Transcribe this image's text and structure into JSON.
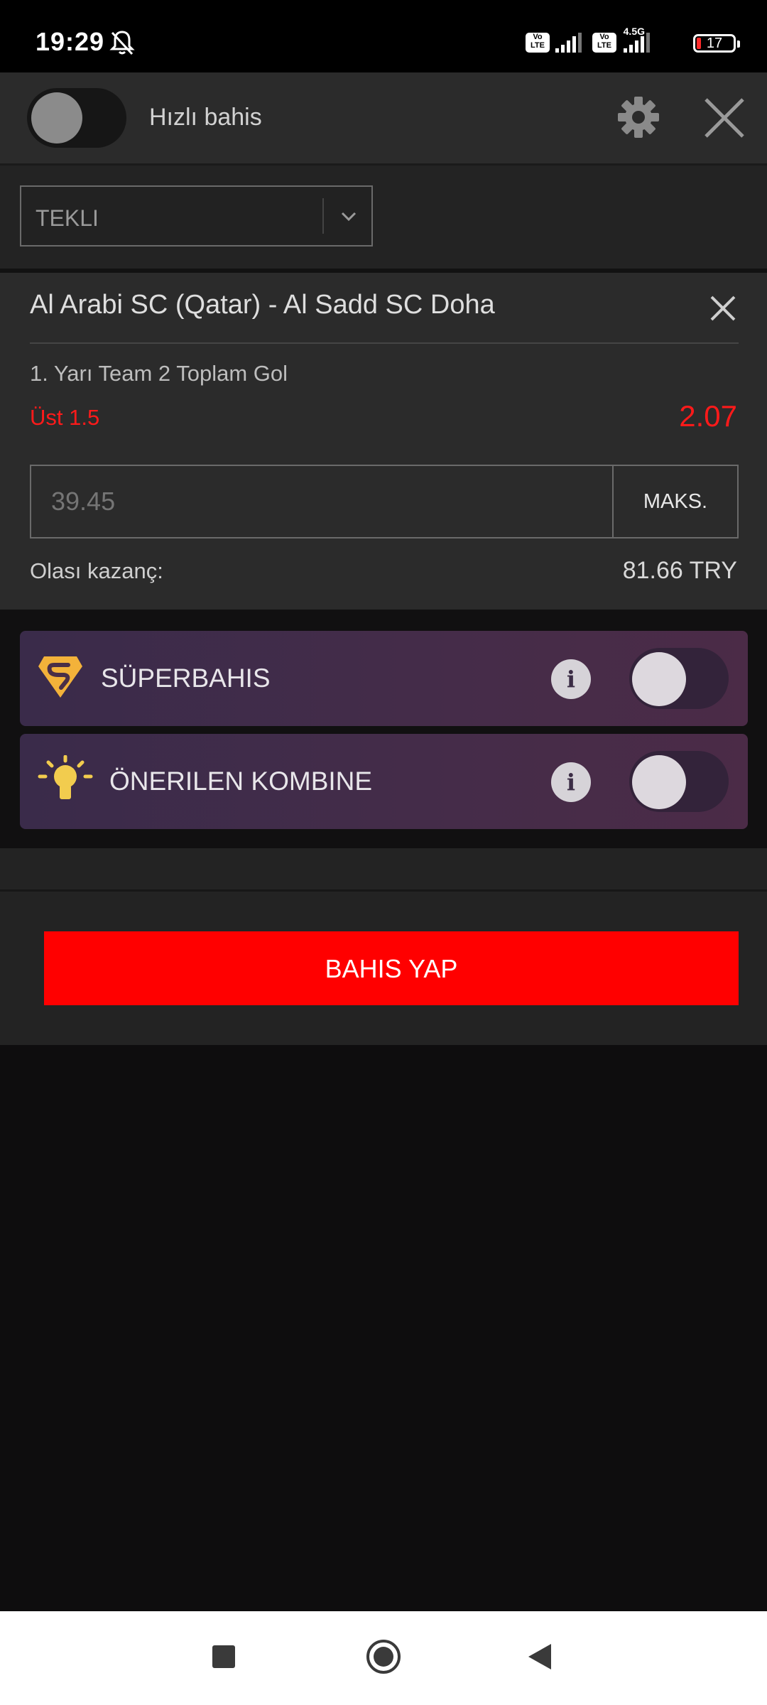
{
  "status_bar": {
    "time": "19:29",
    "volte_1": "Vo LTE",
    "volte_2": "Vo LTE",
    "network_type": "4.5G",
    "battery_level": "17"
  },
  "header": {
    "quick_bet_label": "Hızlı bahis",
    "quick_bet_enabled": false
  },
  "bet_type": {
    "selected": "TEKLI"
  },
  "bet_card": {
    "match": "Al Arabi SC (Qatar) - Al Sadd SC Doha",
    "market": "1. Yarı Team 2 Toplam Gol",
    "selection": "Üst 1.5",
    "odds": "2.07",
    "stake_placeholder": "39.45",
    "max_button": "MAKS.",
    "potential_win_label": "Olası kazanç:",
    "potential_win_value": "81.66 TRY"
  },
  "promos": {
    "superbahis_label": "SÜPERBAHIS",
    "superbahis_enabled": false,
    "combo_label": "ÖNERILEN KOMBINE",
    "combo_enabled": false,
    "info_glyph": "i"
  },
  "submit": {
    "label": "BAHIS YAP"
  },
  "colors": {
    "accent_red": "#ff0000",
    "odds_red": "#ff1a1a",
    "superbahis_gold": "#f3b23a",
    "bulb_yellow": "#f2cc4e"
  }
}
